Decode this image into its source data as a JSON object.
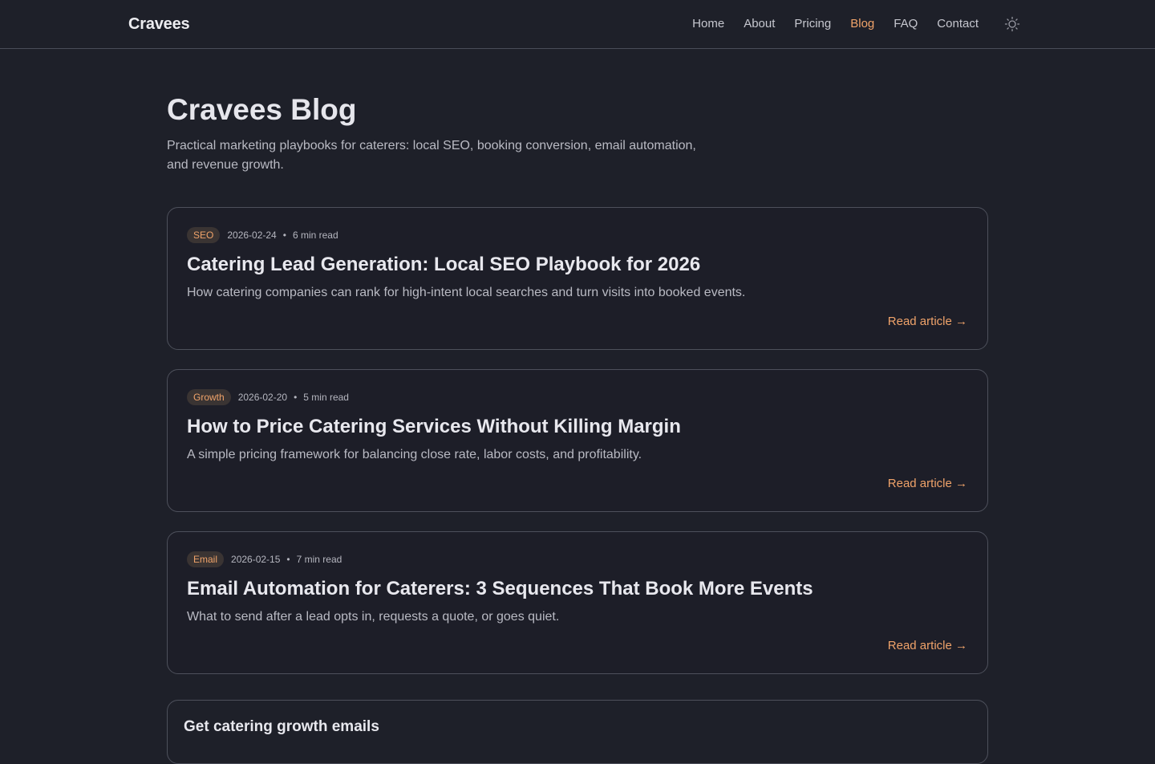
{
  "header": {
    "brand": "Cravees",
    "nav": [
      {
        "label": "Home"
      },
      {
        "label": "About"
      },
      {
        "label": "Pricing"
      },
      {
        "label": "Blog"
      },
      {
        "label": "FAQ"
      },
      {
        "label": "Contact"
      }
    ],
    "active_nav": "Blog",
    "theme_icon": "sun-icon"
  },
  "page": {
    "title": "Cravees Blog",
    "subtitle": "Practical marketing playbooks for caterers: local SEO, booking conversion, email automation, and revenue growth."
  },
  "posts": [
    {
      "tag": "SEO",
      "date": "2026-02-24",
      "read_time": "6 min read",
      "title": "Catering Lead Generation: Local SEO Playbook for 2026",
      "excerpt": "How catering companies can rank for high-intent local searches and turn visits into booked events.",
      "link": "Read article →"
    },
    {
      "tag": "Growth",
      "date": "2026-02-20",
      "read_time": "5 min read",
      "title": "How to Price Catering Services Without Killing Margin",
      "excerpt": "A simple pricing framework for balancing close rate, labor costs, and profitability.",
      "link": "Read article →"
    },
    {
      "tag": "Email",
      "date": "2026-02-15",
      "read_time": "7 min read",
      "title": "Email Automation for Caterers: 3 Sequences That Book More Events",
      "excerpt": "What to send after a lead opts in, requests a quote, or goes quiet.",
      "link": "Read article →"
    }
  ],
  "signup": {
    "title": "Get catering growth emails"
  },
  "colors": {
    "background": "#1e2029",
    "accent": "#f0a36a",
    "border": "#4d505b"
  }
}
